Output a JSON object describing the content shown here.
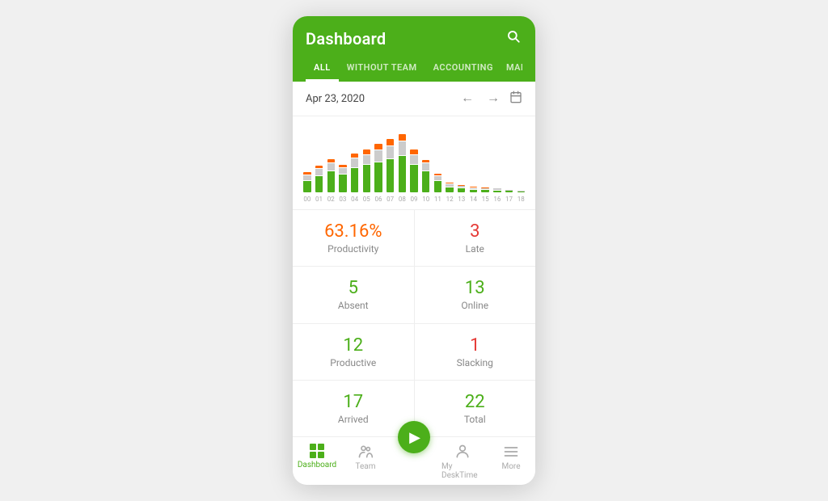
{
  "header": {
    "title": "Dashboard",
    "tabs": [
      {
        "label": "ALL",
        "active": true
      },
      {
        "label": "WITHOUT TEAM",
        "active": false
      },
      {
        "label": "ACCOUNTING",
        "active": false
      },
      {
        "label": "MANAGE",
        "active": false
      }
    ]
  },
  "datebar": {
    "date": "Apr 23, 2020"
  },
  "chart": {
    "labels": [
      "00",
      "01",
      "02",
      "03",
      "04",
      "05",
      "06",
      "07",
      "08",
      "09",
      "10",
      "11",
      "12",
      "13",
      "14",
      "15",
      "16",
      "17",
      "18"
    ],
    "bars": [
      {
        "green": 20,
        "gray": 8,
        "orange": 4
      },
      {
        "green": 28,
        "gray": 10,
        "orange": 5
      },
      {
        "green": 35,
        "gray": 12,
        "orange": 6
      },
      {
        "green": 30,
        "gray": 10,
        "orange": 4
      },
      {
        "green": 40,
        "gray": 15,
        "orange": 7
      },
      {
        "green": 45,
        "gray": 16,
        "orange": 8
      },
      {
        "green": 50,
        "gray": 18,
        "orange": 9
      },
      {
        "green": 55,
        "gray": 20,
        "orange": 10
      },
      {
        "green": 60,
        "gray": 22,
        "orange": 11
      },
      {
        "green": 45,
        "gray": 16,
        "orange": 7
      },
      {
        "green": 35,
        "gray": 12,
        "orange": 5
      },
      {
        "green": 20,
        "gray": 7,
        "orange": 3
      },
      {
        "green": 10,
        "gray": 4,
        "orange": 2
      },
      {
        "green": 8,
        "gray": 3,
        "orange": 1
      },
      {
        "green": 6,
        "gray": 2,
        "orange": 1
      },
      {
        "green": 5,
        "gray": 2,
        "orange": 1
      },
      {
        "green": 4,
        "gray": 2,
        "orange": 0
      },
      {
        "green": 3,
        "gray": 1,
        "orange": 0
      },
      {
        "green": 2,
        "gray": 1,
        "orange": 0
      }
    ]
  },
  "stats": [
    {
      "value": "63.16%",
      "label": "Productivity",
      "color": "orange"
    },
    {
      "value": "3",
      "label": "Late",
      "color": "red"
    },
    {
      "value": "5",
      "label": "Absent",
      "color": "green"
    },
    {
      "value": "13",
      "label": "Online",
      "color": "green"
    },
    {
      "value": "12",
      "label": "Productive",
      "color": "green"
    },
    {
      "value": "1",
      "label": "Slacking",
      "color": "red"
    },
    {
      "value": "17",
      "label": "Arrived",
      "color": "green"
    },
    {
      "value": "22",
      "label": "Total",
      "color": "green"
    }
  ],
  "bottomnav": [
    {
      "label": "Dashboard",
      "active": true,
      "icon": "grid"
    },
    {
      "label": "Team",
      "active": false,
      "icon": "people"
    },
    {
      "label": "",
      "active": false,
      "icon": "play"
    },
    {
      "label": "My DeskTime",
      "active": false,
      "icon": "person"
    },
    {
      "label": "More",
      "active": false,
      "icon": "menu"
    }
  ]
}
